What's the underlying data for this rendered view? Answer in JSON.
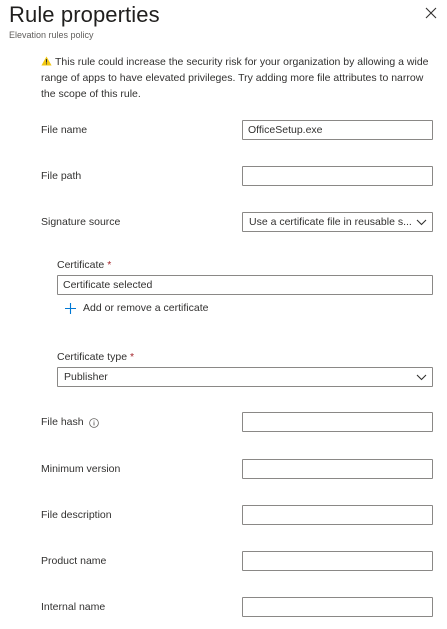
{
  "header": {
    "title": "Rule properties",
    "subtitle": "Elevation rules policy"
  },
  "warning": {
    "text": "This rule could increase the security risk for your organization by allowing a wide range of apps to have elevated privileges. Try adding more file attributes to narrow the scope of this rule."
  },
  "fields": {
    "file_name": {
      "label": "File name",
      "value": "OfficeSetup.exe"
    },
    "file_path": {
      "label": "File path",
      "value": ""
    },
    "signature_source": {
      "label": "Signature source",
      "value": "Use a certificate file in reusable s..."
    },
    "certificate": {
      "label": "Certificate",
      "required_mark": "*",
      "value": "Certificate selected"
    },
    "add_certificate": {
      "label": "Add or remove a certificate"
    },
    "certificate_type": {
      "label": "Certificate type",
      "required_mark": "*",
      "value": "Publisher"
    },
    "file_hash": {
      "label": "File hash",
      "value": ""
    },
    "minimum_version": {
      "label": "Minimum version",
      "value": ""
    },
    "file_description": {
      "label": "File description",
      "value": ""
    },
    "product_name": {
      "label": "Product name",
      "value": ""
    },
    "internal_name": {
      "label": "Internal name",
      "value": ""
    }
  },
  "colors": {
    "warning_icon": "#f2c811",
    "required_mark": "#a4262c",
    "input_border": "#8a8886",
    "add_icon": "#0078d4"
  },
  "icons": {
    "close": "close-icon",
    "warning": "warning-icon",
    "plus": "plus-icon",
    "info": "info-icon",
    "chevron": "chevron-down-icon"
  }
}
